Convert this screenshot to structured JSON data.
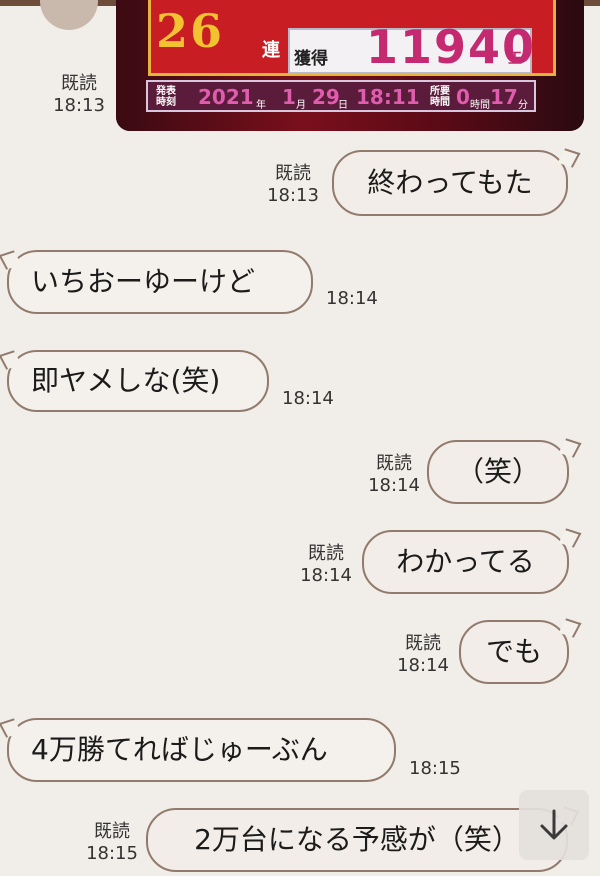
{
  "photo_message": {
    "read_label": "既読",
    "time": "18:13",
    "image": {
      "streak_digits": "26",
      "streak_unit": "連",
      "acquired_label": "獲得",
      "acquired_value": "11940",
      "acquired_unit": "玉",
      "announce_label": "発表\n時刻",
      "year": "2021",
      "year_unit": "年",
      "month": "1",
      "month_unit": "月",
      "day": "29",
      "day_unit": "日",
      "clock": "18:11",
      "required_label": "所要\n時間",
      "hours": "0",
      "hours_unit": "時間",
      "minutes": "17",
      "minutes_unit": "分"
    }
  },
  "messages": [
    {
      "side": "right",
      "text": "終わってもた",
      "read": "既読",
      "time": "18:13"
    },
    {
      "side": "left",
      "text": "いちおーゆーけど",
      "time": "18:14"
    },
    {
      "side": "left",
      "text": "即ヤメしな(笑)",
      "time": "18:14"
    },
    {
      "side": "right",
      "text": "（笑）",
      "read": "既読",
      "time": "18:14"
    },
    {
      "side": "right",
      "text": "わかってる",
      "read": "既読",
      "time": "18:14"
    },
    {
      "side": "right",
      "text": "でも",
      "read": "既読",
      "time": "18:14"
    },
    {
      "side": "left",
      "text": "4万勝てればじゅーぶん",
      "time": "18:15"
    },
    {
      "side": "right",
      "text": "2万台になる予感が（笑）",
      "read": "既読",
      "time": "18:15"
    }
  ],
  "scroll_button": {
    "icon": "arrow-down-icon"
  },
  "colors": {
    "background": "#f1ede8",
    "bubble_border": "#927b6c",
    "bubble_fill": "#f4f0ec",
    "top_bar": "#6e4c3a"
  }
}
